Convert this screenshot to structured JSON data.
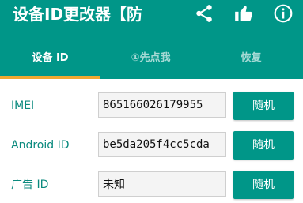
{
  "app": {
    "title": "设备ID更改器【防"
  },
  "toolbar": {
    "icons": [
      "share-icon",
      "thumbs-up-icon",
      "info-icon"
    ]
  },
  "tabs": [
    {
      "label": "设备 ID",
      "active": true
    },
    {
      "label": "①先点我",
      "active": false
    },
    {
      "label": "恢复",
      "active": false
    }
  ],
  "fields": [
    {
      "label": "IMEI",
      "value": "865166026179955",
      "button": "随机"
    },
    {
      "label": "Android ID",
      "value": "be5da205f4cc5cda",
      "button": "随机"
    },
    {
      "label": "广告 ID",
      "value": "未知",
      "button": "随机"
    }
  ],
  "colors": {
    "primary": "#009688",
    "accent": "#f0a830",
    "label_text": "#0a8a7e"
  }
}
